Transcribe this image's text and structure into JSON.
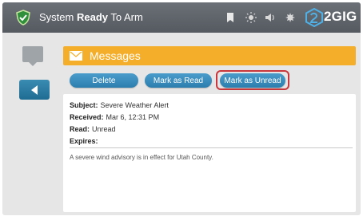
{
  "status": {
    "prefix": "System ",
    "strong": "Ready",
    "suffix": " To Arm"
  },
  "top_icons": [
    "bookmark-icon",
    "sun-icon",
    "speaker-icon",
    "settings-icon"
  ],
  "brand": {
    "name": "2GIG"
  },
  "messages": {
    "title": "Messages"
  },
  "toolbar": {
    "delete_label": "Delete",
    "mark_read_label": "Mark as Read",
    "mark_unread_label": "Mark as Unread"
  },
  "message": {
    "subject_label": "Subject:",
    "subject_value": "Severe Weather Alert",
    "received_label": "Received:",
    "received_value": "Mar 6, 12:31 PM",
    "read_label": "Read:",
    "read_value": "Unread",
    "expires_label": "Expires:",
    "expires_value": "",
    "body": "A severe wind advisory is in effect for Utah County."
  },
  "colors": {
    "accent_orange": "#f5ae2a",
    "button_blue": "#2b7eae",
    "highlight_red": "#c8373b",
    "topbar_gray": "#5e636a"
  }
}
